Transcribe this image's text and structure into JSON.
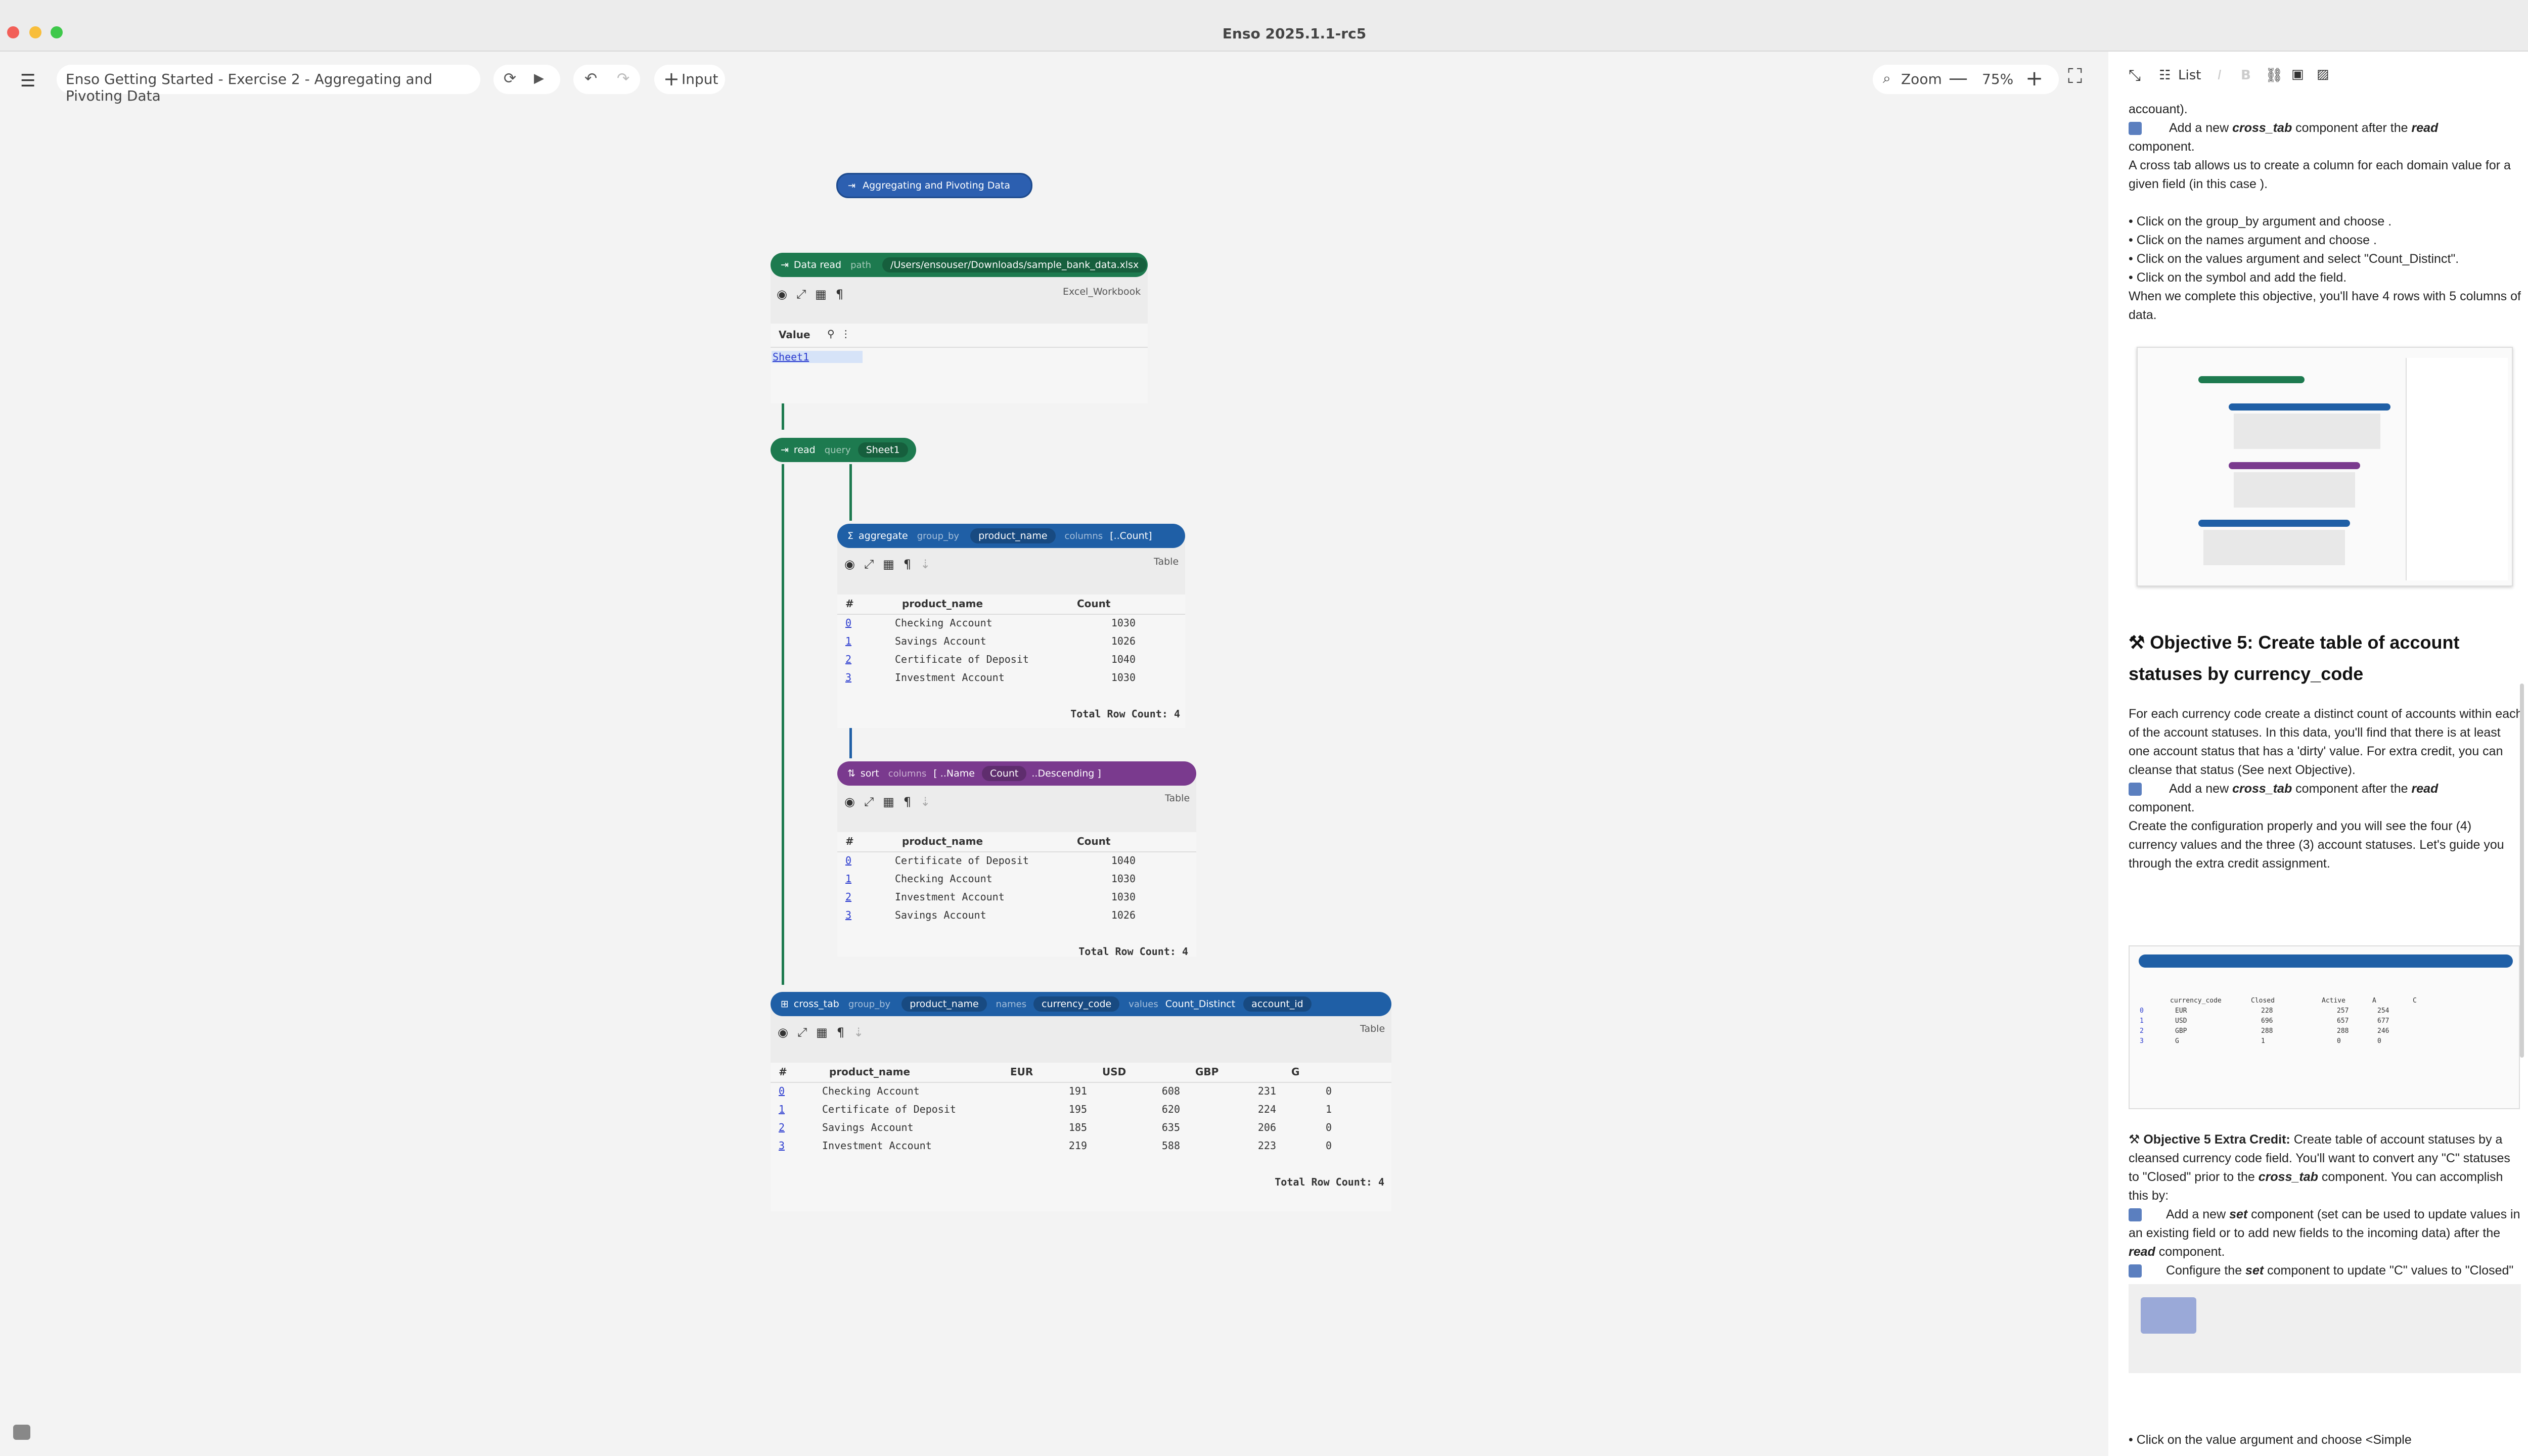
{
  "window": {
    "title": "Enso 2025.1.1-rc5"
  },
  "toolbar": {
    "project_title": "Enso Getting Started - Exercise 2 - Aggregating and Pivoting Data",
    "input_label": "Input",
    "zoom_label": "Zoom",
    "zoom_value": "75%"
  },
  "doc_toolbar": {
    "list_label": "List"
  },
  "nodes": {
    "comment": {
      "text": "Aggregating and Pivoting Data"
    },
    "data_read": {
      "title": "Data read",
      "arg_label": "path",
      "path": "/Users/ensouser/Downloads/sample_bank_data.xlsx",
      "type": "Excel_Workbook",
      "column": "Value",
      "cell": "Sheet1"
    },
    "read": {
      "title": "read",
      "arg_label": "query",
      "query": "Sheet1"
    },
    "aggregate": {
      "title": "aggregate",
      "arg1": "group_by",
      "val1": "product_name",
      "arg2": "columns",
      "val2": "[..Count]",
      "type": "Table",
      "headers": [
        "#",
        "product_name",
        "Count"
      ],
      "rows": [
        [
          "0",
          "Checking Account",
          "1030"
        ],
        [
          "1",
          "Savings Account",
          "1026"
        ],
        [
          "2",
          "Certificate of Deposit",
          "1040"
        ],
        [
          "3",
          "Investment Account",
          "1030"
        ]
      ],
      "footer": "Total Row Count: 4"
    },
    "sort": {
      "title": "sort",
      "arg1": "columns",
      "bracket_open": "[ ..Name",
      "val_chip": "Count",
      "val_rest": "..Descending ]",
      "type": "Table",
      "headers": [
        "#",
        "product_name",
        "Count"
      ],
      "rows": [
        [
          "0",
          "Certificate of Deposit",
          "1040"
        ],
        [
          "1",
          "Checking Account",
          "1030"
        ],
        [
          "2",
          "Investment Account",
          "1030"
        ],
        [
          "3",
          "Savings Account",
          "1026"
        ]
      ],
      "footer": "Total Row Count: 4"
    },
    "cross_tab": {
      "title": "cross_tab",
      "arg1": "group_by",
      "val1": "product_name",
      "arg2": "names",
      "val2": "currency_code",
      "arg3": "values",
      "val3": "Count_Distinct",
      "val4": "account_id",
      "type": "Table",
      "headers": [
        "#",
        "product_name",
        "EUR",
        "USD",
        "GBP",
        "G"
      ],
      "rows": [
        [
          "0",
          "Checking Account",
          "191",
          "608",
          "231",
          "0"
        ],
        [
          "1",
          "Certificate of Deposit",
          "195",
          "620",
          "224",
          "1"
        ],
        [
          "2",
          "Savings Account",
          "185",
          "635",
          "206",
          "0"
        ],
        [
          "3",
          "Investment Account",
          "219",
          "588",
          "223",
          "0"
        ]
      ],
      "footer": "Total Row Count: 4"
    }
  },
  "doc": {
    "p0": "accouant).",
    "p1_a": "Add a new ",
    "p1_b": "cross_tab",
    "p1_c": " component after the ",
    "p1_d": "read",
    "p1_e": "component.",
    "p2": "A cross tab allows us to create a column for each domain value for a given field (in this case ).",
    "bullets": [
      "• Click on the group_by argument and choose .",
      "• Click on the names argument and choose .",
      "• Click on the values argument and select \"Count_Distinct\".",
      "• Click on the  symbol and add the  field."
    ],
    "p3": "When we complete this objective, you'll have 4 rows with 5 columns of data.",
    "obj5_title": "Objective 5:  Create table of account statuses by currency_code",
    "obj5_body": "For each currency code create a distinct count of accounts within each of the account statuses.  In this data, you'll find that there is at least one account status that has a 'dirty' value.  For extra credit, you can cleanse that status (See next Objective).",
    "obj5_step_a": "Add a new ",
    "obj5_step_b": "cross_tab",
    "obj5_step_c": " component after the ",
    "obj5_step_d": "read",
    "obj5_step_e": "component.",
    "obj5_body2": "Create the configuration properly and you will see the four (4) currency values and the three (3) account statuses. Let's guide you through the extra credit assignment.",
    "ec_title": "Objective 5 Extra Credit:",
    "ec_body_a": "  Create table of account statuses by a cleansed currency code field.  You'll want to convert any \"C\" statuses to \"Closed\" prior to the ",
    "ec_body_b": "cross_tab",
    "ec_body_c": " component.  You can accomplish this by:",
    "ec_step1_a": "Add a new ",
    "ec_step1_b": "set",
    "ec_step1_c": " component (set can be used to update values in an existing field or to add new fields to the incoming data) after the ",
    "ec_step1_d": "read",
    "ec_step1_e": " component.",
    "ec_step2_a": "Configure the ",
    "ec_step2_b": "set",
    "ec_step2_c": " component to update \"C\" values to \"Closed\"",
    "last": "• Click on the value argument and choose <Simple"
  },
  "thumb_table": {
    "head": [
      "currency_code",
      "Closed",
      "Active",
      "A",
      "C"
    ],
    "rows": [
      [
        "0",
        "EUR",
        "228",
        "257",
        "254"
      ],
      [
        "1",
        "USD",
        "696",
        "657",
        "677"
      ],
      [
        "2",
        "GBP",
        "288",
        "288",
        "246"
      ],
      [
        "3",
        "G",
        "1",
        "0",
        "0"
      ]
    ]
  },
  "colors": {
    "green": "#1d7a4f",
    "blue": "#1f5fa6",
    "purple": "#7a3a8e",
    "comment_blue": "#2c5fb0"
  }
}
